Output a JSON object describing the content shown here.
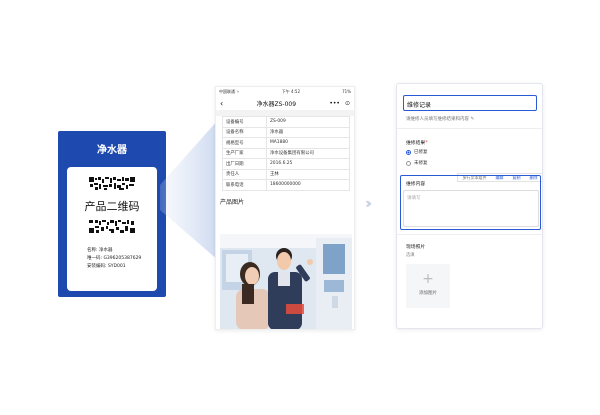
{
  "qr_card": {
    "title": "净水器",
    "label": "产品二维码",
    "info": [
      "名称:   净水器",
      "唯一码:  G396205387629",
      "安装编码:  SYD001"
    ]
  },
  "phone": {
    "status_left": "中国联通 ⚬",
    "status_center": "下午 4:52",
    "status_right": "71%",
    "back_icon": "‹",
    "title": "净水器ZS-009",
    "more_icon": "•••",
    "target_icon": "⊙",
    "rows": [
      {
        "k": "设备编号",
        "v": "ZS-009"
      },
      {
        "k": "设备名称",
        "v": "净水器"
      },
      {
        "k": "规格型号",
        "v": "MA1880"
      },
      {
        "k": "生产厂家",
        "v": "净水设备集团有限公司"
      },
      {
        "k": "出厂日期",
        "v": "2016.6.25"
      },
      {
        "k": "责任人",
        "v": "王林"
      },
      {
        "k": "联系电话",
        "v": "18600000000"
      }
    ],
    "image_title": "产品图片"
  },
  "form": {
    "record_title": "维修记录",
    "subtitle": "请维修人员填写维修结果和内容",
    "result_label": "维修结果",
    "required_mark": "*",
    "option_done": "已修复",
    "option_undone": "未修复",
    "toolbar": {
      "type": "多行文本组件",
      "edit": "编辑",
      "copy": "复制",
      "delete": "删除"
    },
    "content_label": "维修内容",
    "content_placeholder": "请填写",
    "photo_label": "现场照片",
    "photo_hint": "选填",
    "add_photo": "添加图片"
  }
}
